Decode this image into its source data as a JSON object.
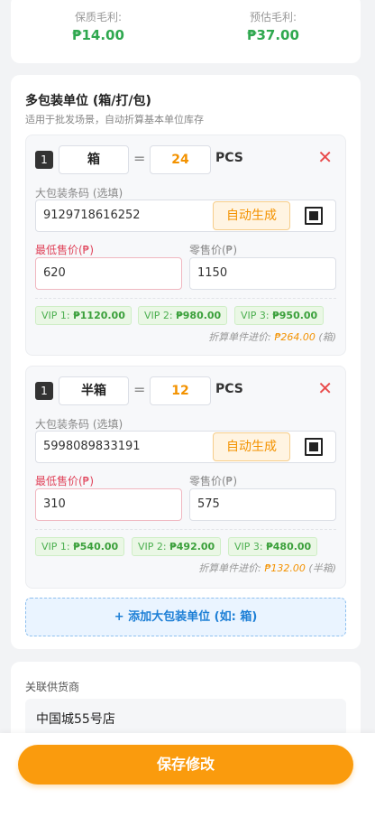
{
  "profit": {
    "guaranteed_label": "保质毛利:",
    "guaranteed_value": "₱14.00",
    "estimated_label": "预估毛利:",
    "estimated_value": "₱37.00"
  },
  "multi_pack": {
    "title": "多包装单位 (箱/打/包)",
    "subtitle": "适用于批发场景，自动折算基本单位库存",
    "barcode_label": "大包装条码 (选填)",
    "generate_label": "自动生成",
    "min_price_label": "最低售价(₱)",
    "retail_price_label": "零售价(₱)",
    "equals": "=",
    "base_unit": "PCS",
    "close": "✕",
    "unit_price_prefix": "折算单件进价:",
    "units": [
      {
        "qty": "1",
        "name": "箱",
        "pcs": "24",
        "barcode": "9129718616252",
        "min_price": "620",
        "retail_price": "1150",
        "vip": [
          {
            "label": "VIP 1:",
            "price": "₱1120.00"
          },
          {
            "label": "VIP 2:",
            "price": "₱980.00"
          },
          {
            "label": "VIP 3:",
            "price": "₱950.00"
          }
        ],
        "unit_price": "₱264.00",
        "unit_suffix": "(箱)"
      },
      {
        "qty": "1",
        "name": "半箱",
        "pcs": "12",
        "barcode": "5998089833191",
        "min_price": "310",
        "retail_price": "575",
        "vip": [
          {
            "label": "VIP 1:",
            "price": "₱540.00"
          },
          {
            "label": "VIP 2:",
            "price": "₱492.00"
          },
          {
            "label": "VIP 3:",
            "price": "₱480.00"
          }
        ],
        "unit_price": "₱132.00",
        "unit_suffix": "(半箱)"
      }
    ],
    "add_button": "+ 添加大包装单位 (如: 箱)"
  },
  "supplier": {
    "label": "关联供货商",
    "value": "中国城55号店"
  },
  "save_button": "保存修改",
  "colors": {
    "accent": "#fa9b0d",
    "profit_green": "#2fa84f",
    "link_blue": "#1d7fd6",
    "danger": "#e94b4b"
  }
}
